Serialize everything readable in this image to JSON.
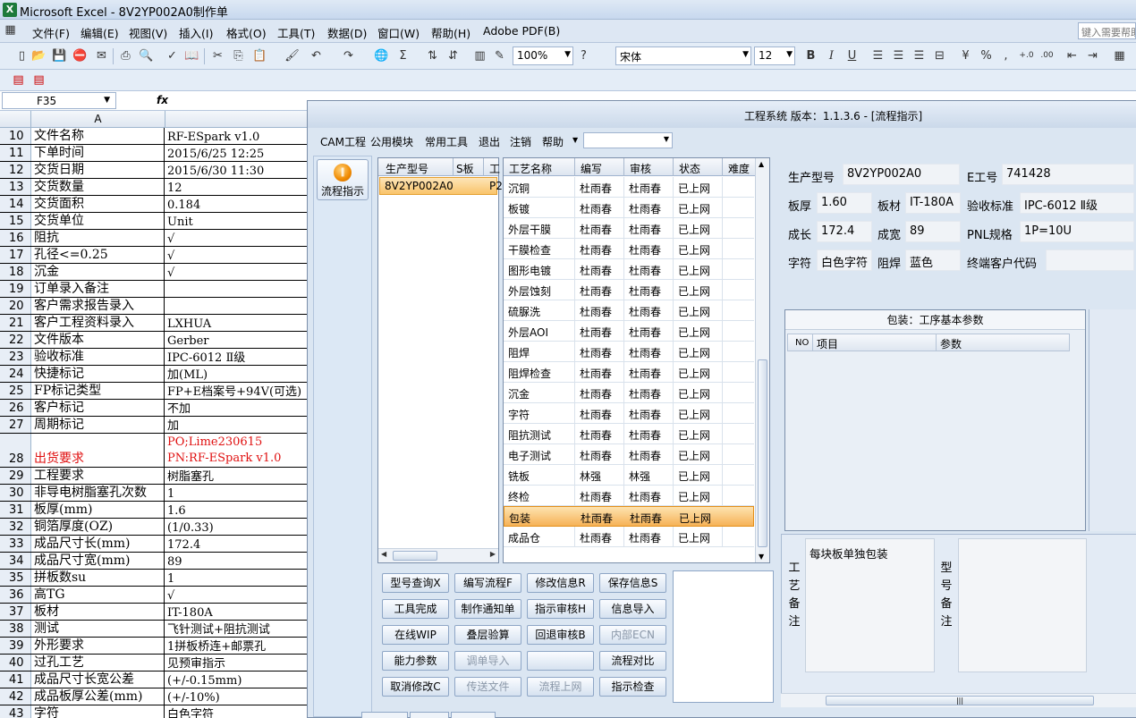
{
  "excel": {
    "title": "Microsoft Excel - 8V2YP002A0制作单",
    "app_icon": "excel-icon",
    "menu": [
      "文件(F)",
      "编辑(E)",
      "视图(V)",
      "插入(I)",
      "格式(O)",
      "工具(T)",
      "数据(D)",
      "窗口(W)",
      "帮助(H)",
      "Adobe PDF(B)"
    ],
    "help_placeholder": "键入需要帮助",
    "zoom": "100%",
    "font_name": "宋体",
    "font_size": "12",
    "name_box": "F35",
    "fx": "fx",
    "column_a": "A",
    "rows": [
      {
        "n": "10",
        "a": "文件名称",
        "b": "RF-ESpark v1.0"
      },
      {
        "n": "11",
        "a": "下单时间",
        "b": "2015/6/25 12:25"
      },
      {
        "n": "12",
        "a": "交货日期",
        "b": "2015/6/30 11:30"
      },
      {
        "n": "13",
        "a": "交货数量",
        "b": "12"
      },
      {
        "n": "14",
        "a": "交货面积",
        "b": "0.184"
      },
      {
        "n": "15",
        "a": "交货单位",
        "b": "Unit"
      },
      {
        "n": "16",
        "a": "阻抗",
        "b": "√"
      },
      {
        "n": "17",
        "a": "孔径<=0.25",
        "b": "√"
      },
      {
        "n": "18",
        "a": "沉金",
        "b": "√"
      },
      {
        "n": "19",
        "a": "订单录入备注",
        "b": ""
      },
      {
        "n": "20",
        "a": "客户需求报告录入",
        "b": ""
      },
      {
        "n": "21",
        "a": "客户工程资料录入",
        "b": "LXHUA"
      },
      {
        "n": "22",
        "a": "文件版本",
        "b": "Gerber"
      },
      {
        "n": "23",
        "a": "验收标准",
        "b": "IPC-6012 Ⅱ级"
      },
      {
        "n": "24",
        "a": "快捷标记",
        "b": "加(ML)"
      },
      {
        "n": "25",
        "a": "FP标记类型",
        "b": "FP+E档案号+94V(可选)"
      },
      {
        "n": "26",
        "a": "客户标记",
        "b": "不加"
      },
      {
        "n": "27",
        "a": "周期标记",
        "b": "加"
      },
      {
        "n": "28",
        "a": "出货要求",
        "b": "PO;Lime230615",
        "b2": "PN:RF-ESpark v1.0"
      },
      {
        "n": "29",
        "a": "工程要求",
        "b": "树脂塞孔"
      },
      {
        "n": "30",
        "a": "非导电树脂塞孔次数",
        "b": "1"
      },
      {
        "n": "31",
        "a": "板厚(mm)",
        "b": "1.6"
      },
      {
        "n": "32",
        "a": "铜箔厚度(OZ)",
        "b": " (1/0.33)"
      },
      {
        "n": "33",
        "a": "成品尺寸长(mm)",
        "b": "172.4"
      },
      {
        "n": "34",
        "a": "成品尺寸宽(mm)",
        "b": "89"
      },
      {
        "n": "35",
        "a": "拼板数su",
        "b": "1"
      },
      {
        "n": "36",
        "a": "高TG",
        "b": "√"
      },
      {
        "n": "37",
        "a": "板材",
        "b": "IT-180A"
      },
      {
        "n": "38",
        "a": "测试",
        "b": "飞针测试+阻抗测试"
      },
      {
        "n": "39",
        "a": "外形要求",
        "b": "1拼板桥连+邮票孔"
      },
      {
        "n": "40",
        "a": "过孔工艺",
        "b": "见预审指示"
      },
      {
        "n": "41",
        "a": "成品尺寸长宽公差",
        "b": "(+/-0.15mm)"
      },
      {
        "n": "42",
        "a": "成品板厚公差(mm)",
        "b": "(+/-10%)"
      },
      {
        "n": "43",
        "a": "字符",
        "b": "白色字符"
      }
    ]
  },
  "cam": {
    "title": "工程系统  版本：1.1.3.6 - [流程指示]",
    "menu": [
      "CAM工程",
      "公用模块",
      "常用工具",
      "退出",
      "注销",
      "帮助"
    ],
    "flow_button": "流程指示",
    "model_table": {
      "headers": [
        "生产型号",
        "S板",
        "工"
      ],
      "selected": "8V2YP002A0",
      "selected_extra": "P2"
    },
    "process_table": {
      "headers": [
        "工艺名称",
        "编写",
        "审核",
        "状态",
        "难度"
      ],
      "rows": [
        [
          "沉铜",
          "杜雨春",
          "杜雨春",
          "已上网"
        ],
        [
          "板镀",
          "杜雨春",
          "杜雨春",
          "已上网"
        ],
        [
          "外层干膜",
          "杜雨春",
          "杜雨春",
          "已上网"
        ],
        [
          "干膜检查",
          "杜雨春",
          "杜雨春",
          "已上网"
        ],
        [
          "图形电镀",
          "杜雨春",
          "杜雨春",
          "已上网"
        ],
        [
          "外层蚀刻",
          "杜雨春",
          "杜雨春",
          "已上网"
        ],
        [
          "硫脲洗",
          "杜雨春",
          "杜雨春",
          "已上网"
        ],
        [
          "外层AOI",
          "杜雨春",
          "杜雨春",
          "已上网"
        ],
        [
          "阻焊",
          "杜雨春",
          "杜雨春",
          "已上网"
        ],
        [
          "阻焊检查",
          "杜雨春",
          "杜雨春",
          "已上网"
        ],
        [
          "沉金",
          "杜雨春",
          "杜雨春",
          "已上网"
        ],
        [
          "字符",
          "杜雨春",
          "杜雨春",
          "已上网"
        ],
        [
          "阻抗测试",
          "杜雨春",
          "杜雨春",
          "已上网"
        ],
        [
          "电子测试",
          "杜雨春",
          "杜雨春",
          "已上网"
        ],
        [
          "铣板",
          "林强",
          "林强",
          "已上网"
        ],
        [
          "终检",
          "杜雨春",
          "杜雨春",
          "已上网"
        ],
        [
          "包装",
          "杜雨春",
          "杜雨春",
          "已上网"
        ],
        [
          "成品仓",
          "杜雨春",
          "杜雨春",
          "已上网"
        ]
      ],
      "selected_index": 16
    },
    "buttons": [
      [
        "型号查询X",
        "编写流程F",
        "修改信息R",
        "保存信息S"
      ],
      [
        "工具完成",
        "制作通知单",
        "指示审核H",
        "信息导入"
      ],
      [
        "在线WIP",
        "叠层验算",
        "回退审核B",
        "内部ECN"
      ],
      [
        "能力参数",
        "调单导入",
        "",
        "流程对比"
      ],
      [
        "取消修改C",
        "传送文件",
        "流程上网",
        "指示检查"
      ]
    ],
    "info": {
      "model_label": "生产型号",
      "model": "8V2YP002A0",
      "e_label": "E工号",
      "e_no": "741428",
      "thick_label": "板厚",
      "thick": "1.60",
      "material_label": "板材",
      "material": "IT-180A",
      "std_label": "验收标准",
      "std": "IPC-6012 Ⅱ级",
      "len_label": "成长",
      "len": "172.4",
      "width_label": "成宽",
      "width": "89",
      "pnl_label": "PNL规格",
      "pnl": "1P=10U",
      "char_label": "字符",
      "char": "白色字符",
      "mask_label": "阻焊",
      "mask": "蓝色",
      "cust_label": "终端客户代码",
      "cust": ""
    },
    "pack": {
      "title": "包装：工序基本参数",
      "headers": [
        "NO",
        "项目",
        "参数"
      ]
    },
    "remarks": {
      "label1": [
        "工",
        "艺",
        "备",
        "注"
      ],
      "text1": "每块板单独包装",
      "label2": [
        "型",
        "号",
        "备",
        "注"
      ]
    }
  }
}
